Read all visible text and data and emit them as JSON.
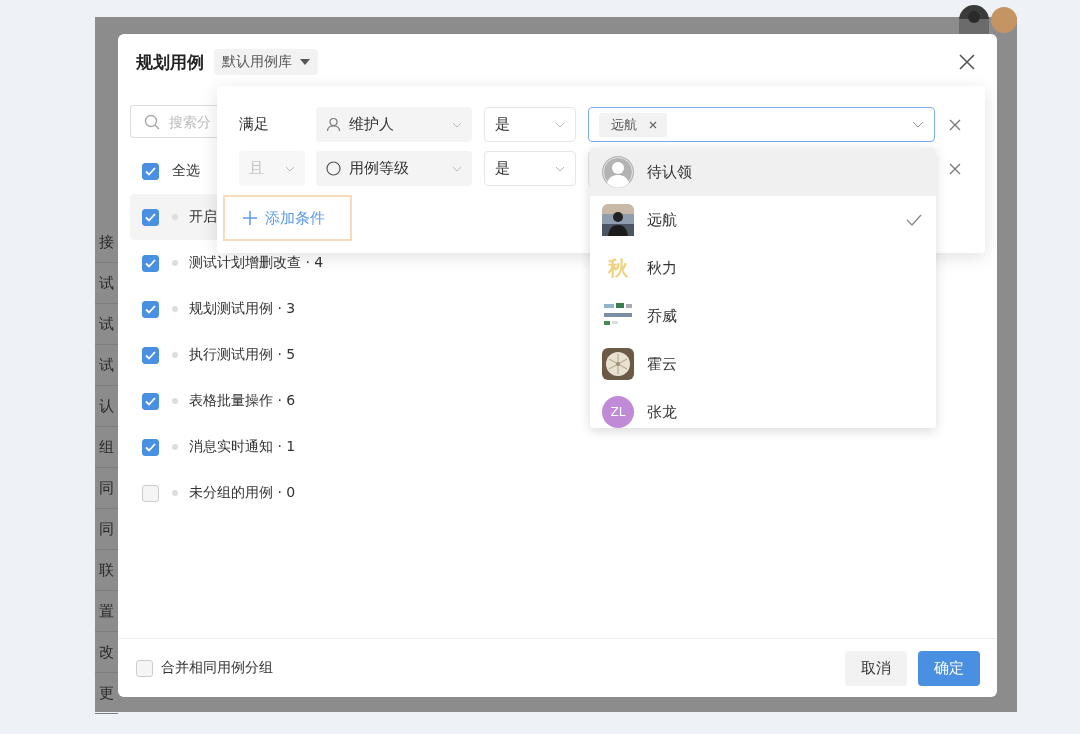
{
  "background": {
    "row_texts": [
      "接",
      "试",
      "试",
      "试",
      "认",
      "组",
      "同",
      "同",
      "联",
      "置",
      "改",
      "更"
    ]
  },
  "dialog": {
    "title": "规划用例",
    "library": "默认用例库",
    "search": {
      "placeholder": "搜索分"
    },
    "select_all": {
      "label": "全选",
      "checked": true
    },
    "groups": [
      {
        "label": "开启",
        "checked": true,
        "highlighted": true
      },
      {
        "label": "测试计划增删改查 · 4",
        "checked": true,
        "highlighted": false
      },
      {
        "label": "规划测试用例 · 3",
        "checked": true,
        "highlighted": false
      },
      {
        "label": "执行测试用例 · 5",
        "checked": true,
        "highlighted": false
      },
      {
        "label": "表格批量操作 · 6",
        "checked": true,
        "highlighted": false
      },
      {
        "label": "消息实时通知 · 1",
        "checked": true,
        "highlighted": false
      },
      {
        "label": "未分组的用例 · 0",
        "checked": false,
        "highlighted": false
      }
    ],
    "filter": {
      "conditions": [
        {
          "kind": "label",
          "connector": "满足",
          "field": "维护人",
          "operator": "是",
          "values": [
            "远航"
          ],
          "focused": true
        },
        {
          "kind": "select",
          "connector": "且",
          "connector_disabled": true,
          "field": "用例等级",
          "operator": "是"
        }
      ],
      "add_button": "添加条件",
      "dropdown": [
        {
          "name": "待认领",
          "avatar": {
            "kind": "default"
          },
          "highlighted": true,
          "selected": false
        },
        {
          "name": "远航",
          "highlighted": false,
          "selected": true
        },
        {
          "name": "秋力",
          "avatar": {
            "kind": "text",
            "text": "秋",
            "color": "#f0d17e"
          },
          "highlighted": false,
          "selected": false
        },
        {
          "name": "乔威",
          "highlighted": false,
          "selected": false
        },
        {
          "name": "霍云",
          "highlighted": false,
          "selected": false
        },
        {
          "name": "张龙",
          "avatar": {
            "kind": "initials",
            "text": "ZL",
            "color": "#c08ad6"
          },
          "highlighted": false,
          "selected": false
        }
      ]
    },
    "merge": {
      "label": "合并相同用例分组",
      "checked": false
    },
    "buttons": [
      {
        "label": "取消",
        "kind": "secondary"
      },
      {
        "label": "确定",
        "kind": "primary"
      }
    ]
  }
}
